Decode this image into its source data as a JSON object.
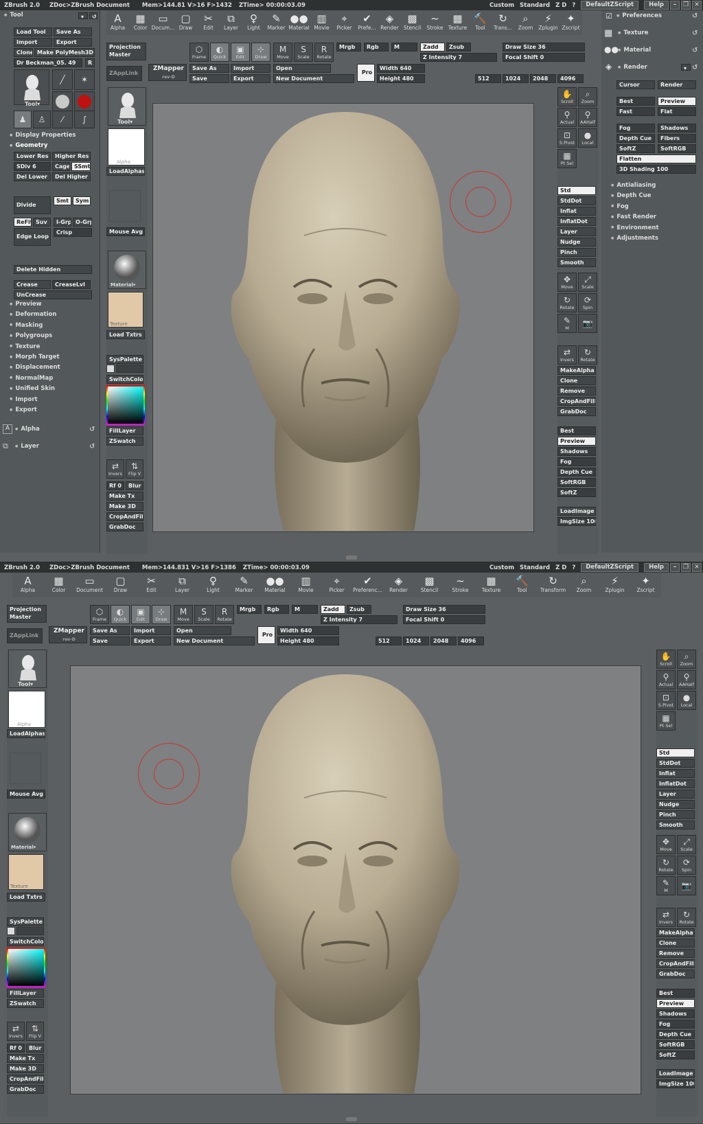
{
  "title": {
    "app": "ZBrush 2.0",
    "doc": "ZDoc>ZBrush Document",
    "mem1": "Mem>144.81  V>16  F>1432",
    "mem2": "Mem>144.831  V>16  F>1386",
    "ztime": "ZTime> 00:00:03.09",
    "custom": "Custom",
    "standard": "Standard",
    "zd": "Z D",
    "q": "?",
    "script": "DefaultZScript",
    "help": "Help"
  },
  "palettes_top": [
    "Alpha",
    "Color",
    "Docum...",
    "Draw",
    "Edit",
    "Layer",
    "Light",
    "Marker",
    "Material",
    "Movie",
    "Picker",
    "Prefe...",
    "Render",
    "Stencil",
    "Stroke",
    "Texture",
    "Tool",
    "Trans...",
    "Zoom",
    "Zplugin",
    "Zscript"
  ],
  "palettes_full": [
    "Alpha",
    "Color",
    "Document",
    "Draw",
    "Edit",
    "Layer",
    "Light",
    "Marker",
    "Material",
    "Movie",
    "Picker",
    "Preferenc...",
    "Render",
    "Stencil",
    "Stroke",
    "Texture",
    "Tool",
    "Transform",
    "Zoom",
    "Zplugin",
    "Zscript"
  ],
  "palette_icons": [
    "A",
    "▦",
    "▭",
    "▢",
    "✂",
    "⧉",
    "♀",
    "✎",
    "●●",
    "▥",
    "⌖",
    "✔",
    "◈",
    "▩",
    "~",
    "▦",
    "🔨",
    "↻",
    "⌕",
    "⚡",
    "✦"
  ],
  "toolbar": {
    "projection_master": "Projection Master",
    "zapplink": "ZAppLink",
    "zmapper": "ZMapper",
    "zmapper_rev": "rev-D",
    "frame": "Frame",
    "quick": "Quick",
    "edit": "Edit",
    "draw": "Draw",
    "move": "Move",
    "scale": "Scale",
    "rotate": "Rotate",
    "mrgb": "Mrgb",
    "rgb": "Rgb",
    "m": "M",
    "zadd": "Zadd",
    "zsub": "Zsub",
    "draw_size": "Draw Size 36",
    "z_intensity": "Z Intensity 7",
    "focal_shift": "Focal Shift 0",
    "save_as": "Save As",
    "import": "Import",
    "open": "Open",
    "save": "Save",
    "export": "Export",
    "new_document": "New Document",
    "pro": "Pro",
    "width": "Width 640",
    "height": "Height 480",
    "sizes": [
      "512",
      "1024",
      "2048",
      "4096"
    ]
  },
  "tool_panel": {
    "title": "Tool",
    "load_tool": "Load Tool",
    "save_as": "Save As",
    "import": "Import",
    "export": "Export",
    "clone": "Clone",
    "make_polymesh": "Make PolyMesh3D",
    "mesh_name": "Dr Beckman_05. 49",
    "r": "R",
    "tool_label": "Tool",
    "display_properties": "Display Properties",
    "geometry": "Geometry",
    "lower_res": "Lower Res",
    "higher_res": "Higher Res",
    "sdiv": "SDiv 6",
    "cage": "Cage",
    "ssmt": "SSmt",
    "del_lower": "Del Lower",
    "del_higher": "Del Higher",
    "divide": "Divide",
    "smt": "Smt",
    "sym": "Sym",
    "refit": "ReFit",
    "suv": "Suv",
    "igrp": "I-Grp",
    "ogrp": "O-Grp",
    "edge_loop": "Edge Loop",
    "crisp": "Crisp",
    "delete_hidden": "Delete Hidden",
    "crease": "Crease",
    "creaselvl": "CreaseLvl",
    "uncrease": "UnCrease",
    "sections": [
      "Preview",
      "Deformation",
      "Masking",
      "Polygroups",
      "Texture",
      "Morph Target",
      "Displacement",
      "NormalMap",
      "Unified Skin",
      "Import",
      "Export"
    ],
    "alpha": "Alpha",
    "layer": "Layer"
  },
  "left_shelf": {
    "tool": "Tool",
    "alpha": "Alpha",
    "load_alphas": "LoadAlphas",
    "mouse_avg": "Mouse Avg",
    "material": "Material",
    "texture": "Texture",
    "load_txtrs": "Load Txtrs",
    "syspalette": "SysPalette",
    "switchcolor": "SwitchColor",
    "filllayer": "FillLayer",
    "zswatch": "ZSwatch",
    "invers": "Invers",
    "flipv": "Flip V",
    "rf": "Rf 0",
    "blur": "Blur",
    "make_tx": "Make Tx",
    "make_3d": "Make 3D",
    "cropandfill": "CropAndFill",
    "grabdoc": "GrabDoc"
  },
  "right_shelf": {
    "scroll": "Scroll",
    "zoom": "Zoom",
    "actual": "Actual",
    "aahalf": "AAHalf",
    "spivot": "S.Pivot",
    "local": "Local",
    "ptsel": "Pt Sel",
    "brushes": [
      "Std",
      "StdDot",
      "Inflat",
      "InflatDot",
      "Layer",
      "Nudge",
      "Pinch",
      "Smooth"
    ],
    "move": "Move",
    "scale": "Scale",
    "rotate": "Rotate",
    "spin": "Spin",
    "m": "M",
    "invers": "Invers",
    "rotate2": "Rotate",
    "makealpha": "MakeAlpha",
    "clone": "Clone",
    "remove": "Remove",
    "cropandfill": "CropAndFill",
    "grabdoc": "GrabDoc",
    "render_modes": [
      "Best",
      "Preview",
      "Shadows",
      "Fog",
      "Depth Cue",
      "SoftRGB",
      "SoftZ"
    ],
    "loadimage": "LoadImage",
    "imgsize": "ImgSize 100"
  },
  "render_panel": {
    "preferences": "Preferences",
    "texture": "Texture",
    "material": "Material",
    "render": "Render",
    "cursor": "Cursor",
    "render_btn": "Render",
    "best": "Best",
    "preview": "Preview",
    "fast": "Fast",
    "flat": "Flat",
    "fog": "Fog",
    "shadows": "Shadows",
    "depth_cue": "Depth Cue",
    "fibers": "Fibers",
    "softz": "SoftZ",
    "softrgb": "SoftRGB",
    "flatten": "Flatten",
    "shading": "3D Shading 100",
    "sections": [
      "Antialiasing",
      "Depth Cue",
      "Fog",
      "Fast Render",
      "Environment",
      "Adjustments"
    ]
  },
  "colors": {
    "ui_bg": "#5b5f61",
    "button": "#414648",
    "canvas": "#7e8082",
    "skin": "#b8ad96",
    "brush_ring": "#c8362e",
    "texture_swatch": "#e1c9a8"
  }
}
